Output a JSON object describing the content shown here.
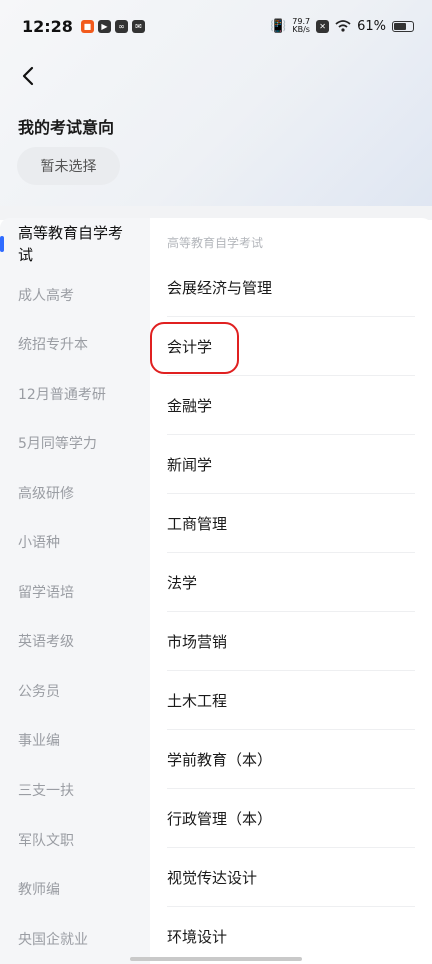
{
  "status_bar": {
    "time": "12:28",
    "net_speed_value": "79.7",
    "net_speed_unit": "KB/s",
    "battery": "61%"
  },
  "header": {
    "section_title": "我的考试意向",
    "selection_chip": "暂未选择"
  },
  "sidebar": {
    "items": [
      {
        "label": "高等教育自学考试",
        "active": true
      },
      {
        "label": "成人高考"
      },
      {
        "label": "统招专升本"
      },
      {
        "label": "12月普通考研"
      },
      {
        "label": "5月同等学力"
      },
      {
        "label": "高级研修"
      },
      {
        "label": "小语种"
      },
      {
        "label": "留学语培"
      },
      {
        "label": "英语考级"
      },
      {
        "label": "公务员"
      },
      {
        "label": "事业编"
      },
      {
        "label": "三支一扶"
      },
      {
        "label": "军队文职"
      },
      {
        "label": "教师编"
      },
      {
        "label": "央国企就业"
      }
    ]
  },
  "content": {
    "header": "高等教育自学考试",
    "majors": [
      "会展经济与管理",
      "会计学",
      "金融学",
      "新闻学",
      "工商管理",
      "法学",
      "市场营销",
      "土木工程",
      "学前教育（本）",
      "行政管理（本）",
      "视觉传达设计",
      "环境设计"
    ]
  },
  "colors": {
    "accent": "#2f6bff",
    "highlight": "#e02020"
  }
}
